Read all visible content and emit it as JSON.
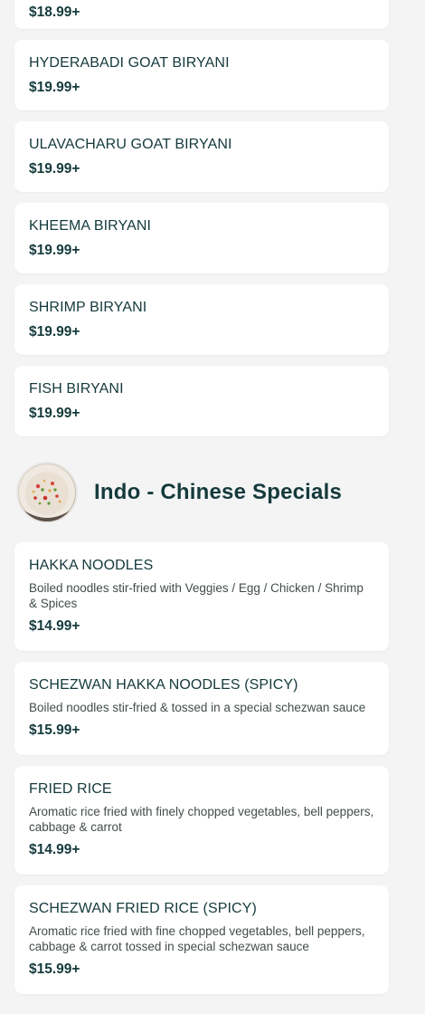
{
  "menu": {
    "top_partial_item": {
      "name": "",
      "price": "$18.99+"
    },
    "biryani_items": [
      {
        "name": "HYDERABADI GOAT BIRYANI",
        "price": "$19.99+"
      },
      {
        "name": "ULAVACHARU GOAT BIRYANI",
        "price": "$19.99+"
      },
      {
        "name": "KHEEMA BIRYANI",
        "price": "$19.99+"
      },
      {
        "name": "SHRIMP BIRYANI",
        "price": "$19.99+"
      },
      {
        "name": "FISH BIRYANI",
        "price": "$19.99+"
      }
    ],
    "section": {
      "title": "Indo - Chinese Specials",
      "thumb_icon": "fried-rice-photo"
    },
    "indo_chinese_items": [
      {
        "name": "HAKKA NOODLES",
        "description": "Boiled noodles stir-fried with Veggies / Egg / Chicken / Shrimp & Spices",
        "price": "$14.99+"
      },
      {
        "name": "SCHEZWAN HAKKA NOODLES (SPICY)",
        "description": "Boiled noodles stir-fried & tossed in a special schezwan sauce",
        "price": "$15.99+"
      },
      {
        "name": "FRIED RICE",
        "description": "Aromatic rice fried with finely chopped vegetables, bell peppers, cabbage & carrot",
        "price": "$14.99+"
      },
      {
        "name": "SCHEZWAN FRIED RICE (SPICY)",
        "description": "Aromatic rice fried with fine chopped vegetables, bell peppers, cabbage & carrot tossed in special schezwan sauce",
        "price": "$15.99+"
      }
    ]
  }
}
